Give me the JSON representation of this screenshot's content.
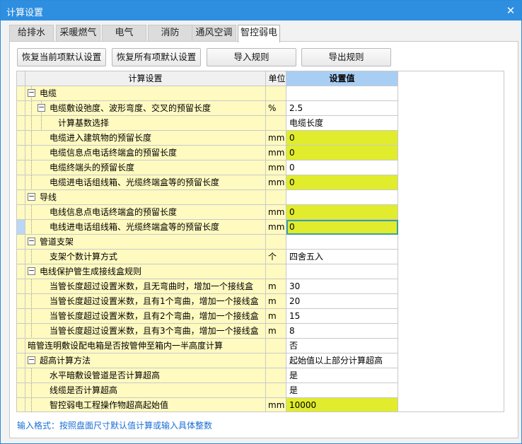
{
  "window": {
    "title": "计算设置",
    "close_glyph": "✕"
  },
  "tabs": [
    "给排水",
    "采暖燃气",
    "电气",
    "消防",
    "通风空调",
    "智控弱电"
  ],
  "active_tab": "智控弱电",
  "toolbar": {
    "restore_current": "恢复当前项默认设置",
    "restore_all": "恢复所有项默认设置",
    "import_rules": "导入规则",
    "export_rules": "导出规则"
  },
  "table": {
    "headers": {
      "setting": "计算设置",
      "unit": "单位",
      "value": "设置值"
    },
    "rows": [
      {
        "label": "电缆",
        "unit": "",
        "value": "",
        "highlight": false
      },
      {
        "label": "电缆敷设弛度、波形弯度、交叉的预留长度",
        "unit": "%",
        "value": "2.5",
        "highlight": false
      },
      {
        "label": "计算基数选择",
        "unit": "",
        "value": "电缆长度",
        "highlight": false
      },
      {
        "label": "电缆进入建筑物的预留长度",
        "unit": "mm",
        "value": "0",
        "highlight": true
      },
      {
        "label": "电缆信息点电话终端盒的预留长度",
        "unit": "mm",
        "value": "0",
        "highlight": true
      },
      {
        "label": "电缆终端头的预留长度",
        "unit": "mm",
        "value": "0",
        "highlight": false
      },
      {
        "label": "电缆进电话组线箱、光缆终端盒等的预留长度",
        "unit": "mm",
        "value": "0",
        "highlight": true
      },
      {
        "label": "导线",
        "unit": "",
        "value": "",
        "highlight": false
      },
      {
        "label": "电线信息点电话终端盒的预留长度",
        "unit": "mm",
        "value": "0",
        "highlight": true
      },
      {
        "label": "电线进电话组线箱、光缆终端盒等的预留长度",
        "unit": "mm",
        "value": "0",
        "highlight": true
      },
      {
        "label": "管道支架",
        "unit": "",
        "value": "",
        "highlight": false
      },
      {
        "label": "支架个数计算方式",
        "unit": "个",
        "value": "四舍五入",
        "highlight": false
      },
      {
        "label": "电线保护管生成接线盒规则",
        "unit": "",
        "value": "",
        "highlight": false
      },
      {
        "label": "当管长度超过设置米数，且无弯曲时，增加一个接线盒",
        "unit": "m",
        "value": "30",
        "highlight": false
      },
      {
        "label": "当管长度超过设置米数，且有1个弯曲，增加一个接线盒",
        "unit": "m",
        "value": "20",
        "highlight": false
      },
      {
        "label": "当管长度超过设置米数，且有2个弯曲，增加一个接线盒",
        "unit": "m",
        "value": "15",
        "highlight": false
      },
      {
        "label": "当管长度超过设置米数，且有3个弯曲，增加一个接线盒",
        "unit": "m",
        "value": "8",
        "highlight": false
      },
      {
        "label": "暗管连明敷设配电箱是否按管伸至箱内一半高度计算",
        "unit": "",
        "value": "否",
        "highlight": false
      },
      {
        "label": "超高计算方法",
        "unit": "",
        "value": "起始值以上部分计算超高",
        "highlight": false
      },
      {
        "label": "水平暗敷设管道是否计算超高",
        "unit": "",
        "value": "是",
        "highlight": false
      },
      {
        "label": "线缆是否计算超高",
        "unit": "",
        "value": "是",
        "highlight": false
      },
      {
        "label": "智控弱电工程操作物超高起始值",
        "unit": "mm",
        "value": "10000",
        "highlight": true
      }
    ]
  },
  "hint_text": "输入格式：按照盘面尺寸默认值计算或输入具体整数",
  "colors": {
    "titlebar": "#2e8ee0",
    "label_cell": "#fffac0",
    "highlight_value": "#e0ec2c",
    "header_value": "#a9cef4",
    "hint": "#1a6fd4"
  }
}
